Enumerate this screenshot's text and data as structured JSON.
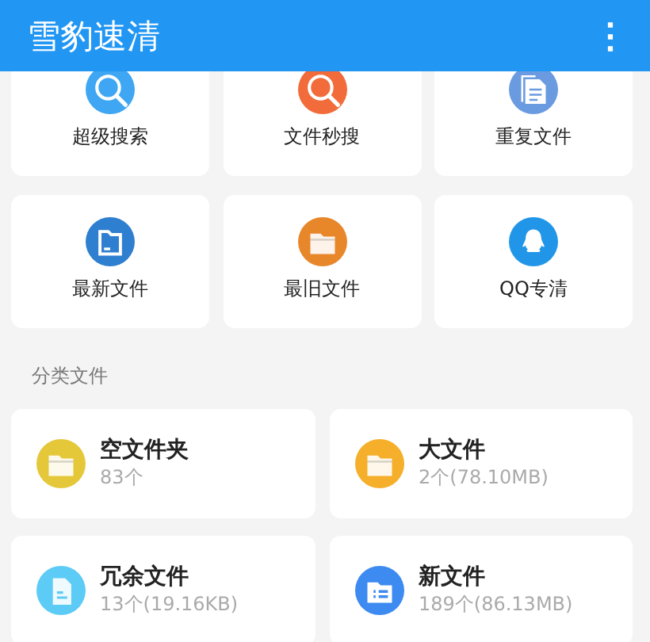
{
  "app_bar": {
    "title": "雪豹速清",
    "menu": "⋮"
  },
  "tools": [
    {
      "label": "超级搜索",
      "kind": "search",
      "color": "#3ea6f2"
    },
    {
      "label": "文件秒搜",
      "kind": "search",
      "color": "#f26b3a"
    },
    {
      "label": "重复文件",
      "kind": "copies",
      "color": "#6a9be0"
    },
    {
      "label": "最新文件",
      "kind": "file",
      "color": "#2f7fd0"
    },
    {
      "label": "最旧文件",
      "kind": "folder",
      "color": "#e8862a"
    },
    {
      "label": "QQ专清",
      "kind": "penguin",
      "color": "#2196e8"
    }
  ],
  "section_title": "分类文件",
  "categories": [
    {
      "name": "空文件夹",
      "detail": "83个",
      "kind": "folder",
      "color": "#e5c83a"
    },
    {
      "name": "大文件",
      "detail": "2个(78.10MB)",
      "kind": "folder",
      "color": "#f5af2a"
    },
    {
      "name": "冗余文件",
      "detail": "13个(19.16KB)",
      "kind": "doc",
      "color": "#5ccbf5"
    },
    {
      "name": "新文件",
      "detail": "189个(86.13MB)",
      "kind": "list",
      "color": "#3d8af0"
    }
  ]
}
